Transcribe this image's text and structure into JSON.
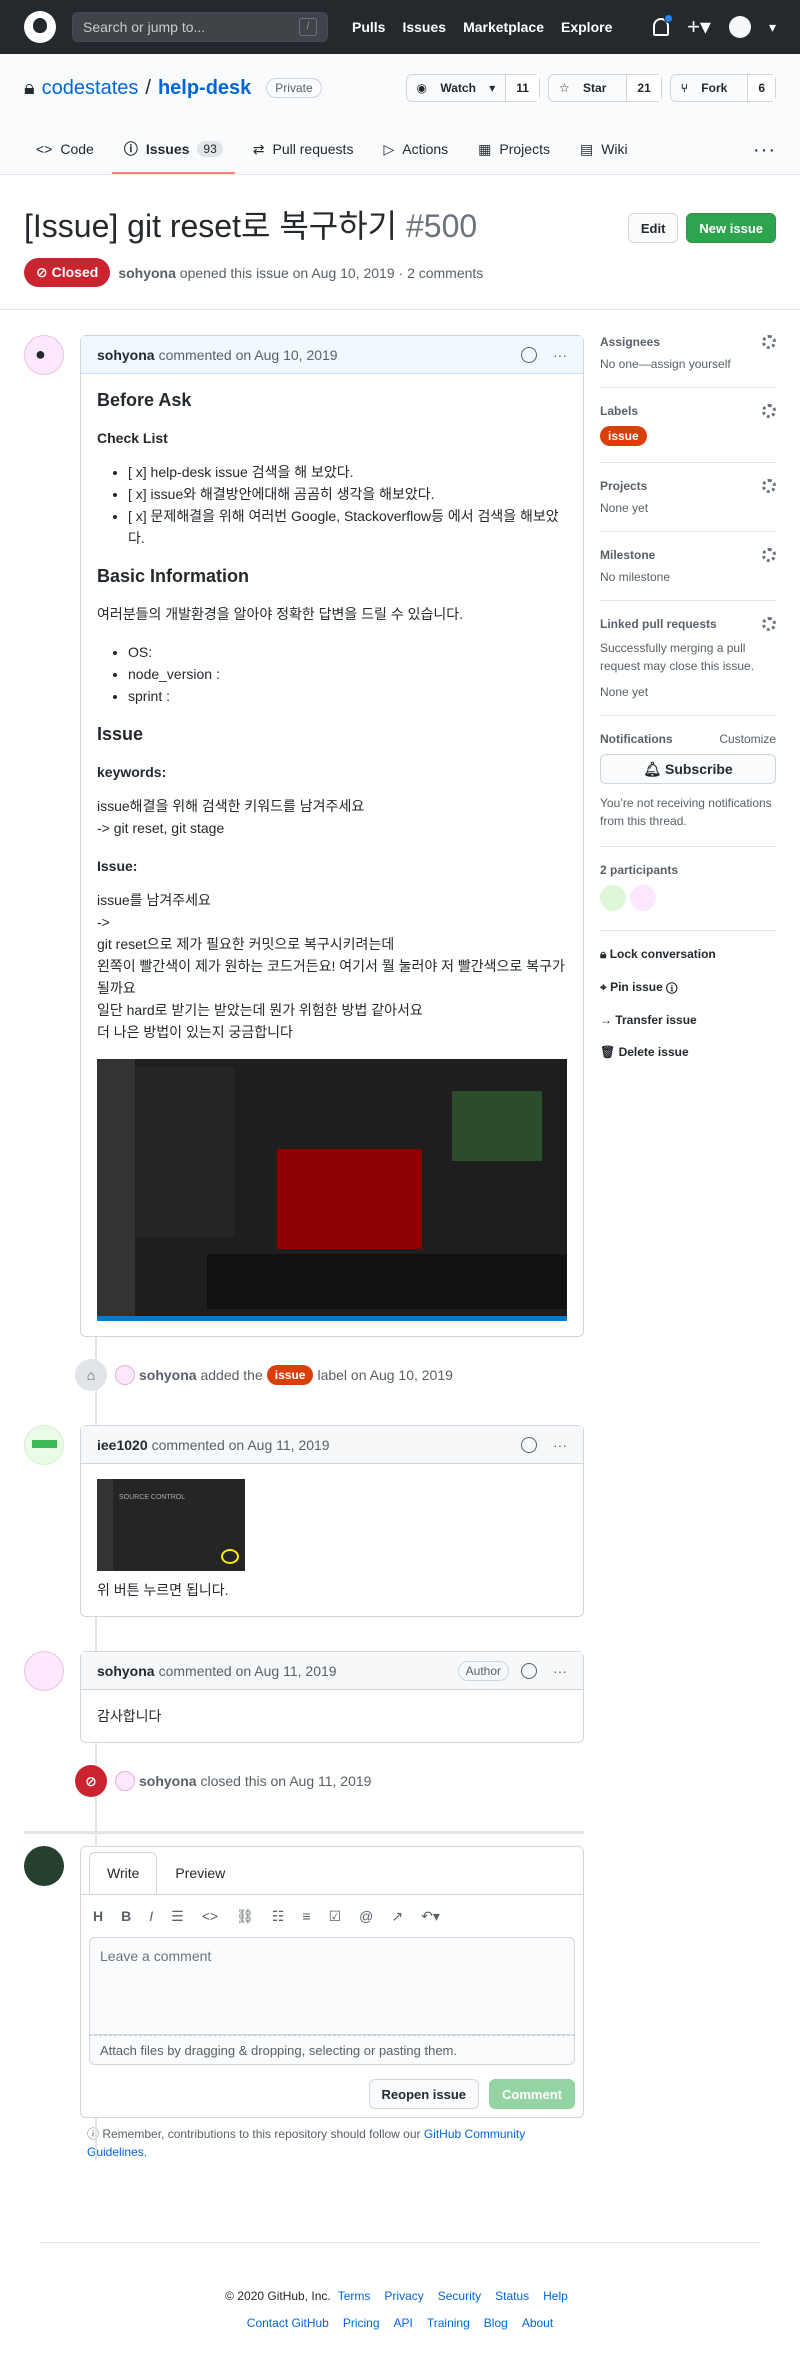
{
  "header": {
    "search_placeholder": "Search or jump to...",
    "nav": [
      "Pulls",
      "Issues",
      "Marketplace",
      "Explore"
    ]
  },
  "repo": {
    "owner": "codestates",
    "name": "help-desk",
    "visibility": "Private",
    "watch": "Watch",
    "watch_count": "11",
    "star": "Star",
    "star_count": "21",
    "fork": "Fork",
    "fork_count": "6"
  },
  "tabs": [
    {
      "label": "Code"
    },
    {
      "label": "Issues",
      "count": "93"
    },
    {
      "label": "Pull requests"
    },
    {
      "label": "Actions"
    },
    {
      "label": "Projects"
    },
    {
      "label": "Wiki"
    }
  ],
  "issue": {
    "title": "[Issue] git reset로 복구하기",
    "number": "#500",
    "state": "Closed",
    "author": "sohyona",
    "opened": "opened this issue on Aug 10, 2019 · 2 comments",
    "edit": "Edit",
    "new_issue": "New issue"
  },
  "comments": [
    {
      "author": "sohyona",
      "time": "commented on Aug 10, 2019",
      "h_before": "Before Ask",
      "h_check": "Check List",
      "checks": [
        "[ x] help-desk issue 검색을 해 보았다.",
        "[ x] issue와 해결방안에대해 곰곰히 생각을 해보았다.",
        "[ x] 문제해결을 위해 여러번 Google, Stackoverflow등 에서 검색을 해보았다."
      ],
      "h_basic": "Basic Information",
      "basic_text": "여러분들의 개발환경을 알아야 정확한 답변을 드릴 수 있습니다.",
      "env": [
        "OS:",
        "node_version :",
        "sprint :"
      ],
      "h_issue": "Issue",
      "h_keywords": "keywords:",
      "keyword_text1": "issue해결을 위해 검색한 키워드를 남겨주세요",
      "keyword_text2": "-> git reset, git stage",
      "h_issue2": "Issue:",
      "issue_lines": [
        "issue를 남겨주세요",
        "->",
        "git reset으로 제가 필요한 커밋으로 복구시키려는데",
        "왼쪽이 빨간색이 제가 원하는 코드거든요! 여기서 뭘 눌러야 저 빨간색으로 복구가 될까요",
        "일단 hard로 받기는 받았는데 뭔가 위험한 방법 같아서요",
        "더 나은 방법이 있는지 궁금합니다"
      ]
    },
    {
      "author": "iee1020",
      "time": "commented on Aug 11, 2019",
      "text": "위 버튼 누르면 됩니다."
    },
    {
      "author": "sohyona",
      "time": "commented on Aug 11, 2019",
      "badge": "Author",
      "text": "감사합니다"
    }
  ],
  "events": [
    {
      "author": "sohyona",
      "before": "added the",
      "label": "issue",
      "after": "label on Aug 10, 2019"
    },
    {
      "author": "sohyona",
      "text": "closed this on Aug 11, 2019"
    }
  ],
  "editor": {
    "write": "Write",
    "preview": "Preview",
    "placeholder": "Leave a comment",
    "attach": "Attach files by dragging & dropping, selecting or pasting them.",
    "reopen": "Reopen issue",
    "comment": "Comment",
    "guide_prefix": "Remember, contributions to this repository should follow our",
    "guide_link": "GitHub Community Guidelines."
  },
  "sidebar": {
    "assignees": "Assignees",
    "assign_text": "No one—assign yourself",
    "labels": "Labels",
    "label": "issue",
    "projects": "Projects",
    "projects_text": "None yet",
    "milestone": "Milestone",
    "milestone_text": "No milestone",
    "linked": "Linked pull requests",
    "linked_text": "Successfully merging a pull request may close this issue.",
    "linked_none": "None yet",
    "notifications": "Notifications",
    "customize": "Customize",
    "subscribe": "Subscribe",
    "notice": "You’re not receiving notifications from this thread.",
    "participants": "2 participants",
    "lock": "Lock conversation",
    "pin": "Pin issue",
    "transfer": "Transfer issue",
    "delete": "Delete issue"
  },
  "footer": {
    "copyright": "© 2020 GitHub, Inc.",
    "links1": [
      "Terms",
      "Privacy",
      "Security",
      "Status",
      "Help"
    ],
    "links2": [
      "Contact GitHub",
      "Pricing",
      "API",
      "Training",
      "Blog",
      "About"
    ]
  }
}
